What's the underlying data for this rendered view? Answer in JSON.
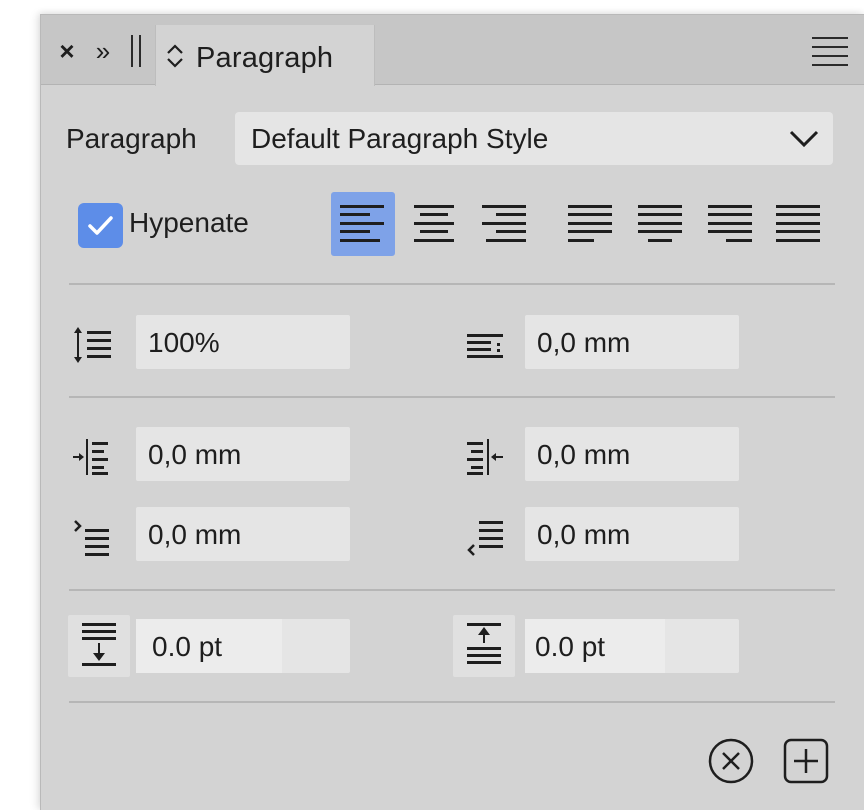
{
  "panel": {
    "tab_title": "Paragraph",
    "icons": {
      "close": "close-icon",
      "collapse": "double-chevron-right-icon",
      "grip": "grip-icon",
      "tab_toggle": "up-down-chevron-icon",
      "menu": "hamburger-menu-icon"
    }
  },
  "style_row": {
    "label": "Paragraph",
    "selected_style": "Default Paragraph Style"
  },
  "hyphenate": {
    "label": "Hypenate",
    "checked": true
  },
  "alignment": {
    "active": "align-left",
    "options": [
      "align-left",
      "align-center",
      "align-right",
      "justify-left",
      "justify-center",
      "justify-right",
      "justify-all"
    ]
  },
  "spacing": {
    "line_spacing": "100%",
    "first_line_indent": "0,0 mm"
  },
  "indents": {
    "left_indent": "0,0 mm",
    "right_indent": "0,0 mm",
    "start_indent": "0,0 mm",
    "end_indent": "0,0 mm"
  },
  "paragraph_space": {
    "space_before": "0.0 pt",
    "space_after": "0.0 pt"
  },
  "footer": {
    "icons": [
      "clear-circle-icon",
      "add-square-icon"
    ]
  },
  "colors": {
    "panel_bg": "#d3d3d3",
    "field_bg": "#e5e5e5",
    "accent": "#5d8de8",
    "active_align": "#7ea2e8"
  }
}
